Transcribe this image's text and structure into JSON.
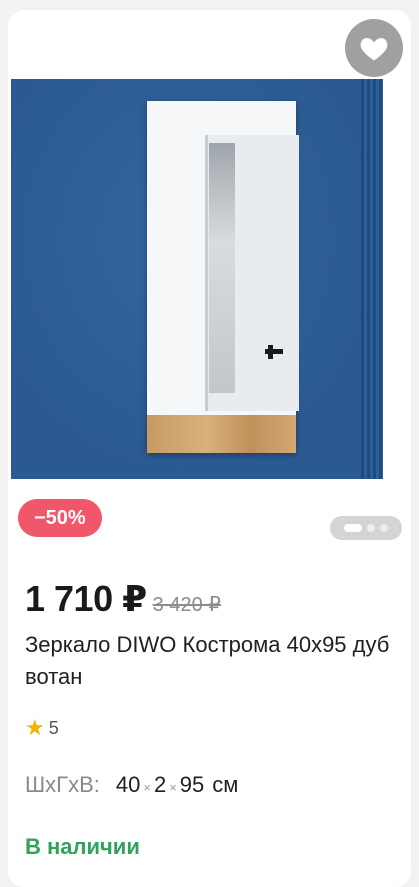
{
  "product": {
    "image_alt": "Зеркало DIWO Кострома",
    "favorite_icon": "heart-icon",
    "discount_badge": "−50%",
    "price": "1 710 ₽",
    "old_price": "3 420 ₽",
    "title": "Зеркало DIWO Кострома 40х95 дуб вотан",
    "rating": "5",
    "dims": {
      "label": "ШхГхВ:",
      "w": "40",
      "d": "2",
      "h": "95",
      "unit": "см",
      "sep": "×"
    },
    "stock_status": "В наличии",
    "colors": {
      "accent_red": "#f0576a",
      "in_stock_green": "#2fa35a",
      "star_yellow": "#f4b400"
    }
  }
}
